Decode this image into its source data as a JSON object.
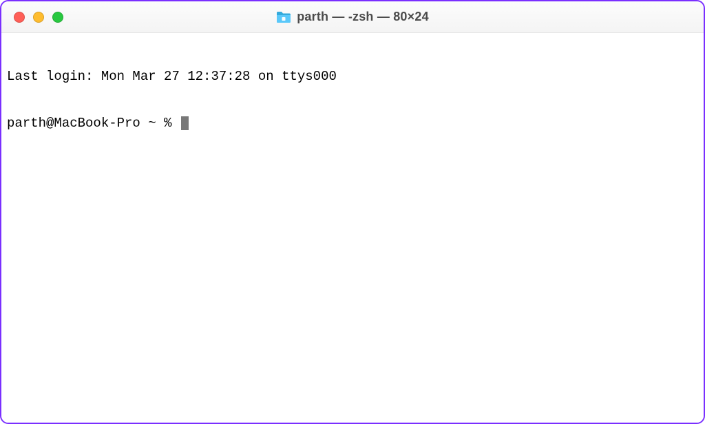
{
  "window": {
    "title": "parth — -zsh — 80×24"
  },
  "terminal": {
    "last_login_line": "Last login: Mon Mar 27 12:37:28 on ttys000",
    "prompt": "parth@MacBook-Pro ~ % "
  }
}
